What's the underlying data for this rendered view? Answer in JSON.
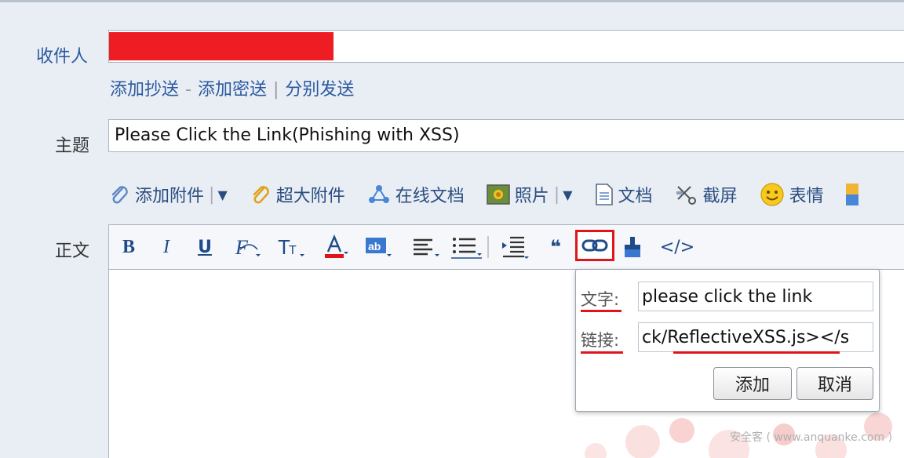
{
  "form": {
    "to_label": "收件人",
    "cc_link": "添加抄送",
    "cc_sep": "-",
    "bcc_link": "添加密送",
    "split_sep": "|",
    "split_link": "分别发送",
    "subject_label": "主题",
    "subject_value": "Please Click the Link(Phishing with XSS)",
    "body_label": "正文"
  },
  "attach_bar": {
    "attach": "添加附件",
    "big_attach": "超大附件",
    "online_doc": "在线文档",
    "photo": "照片",
    "doc": "文档",
    "screenshot": "截屏",
    "emoji": "表情"
  },
  "toolbar": {
    "bold": "B",
    "italic": "I",
    "underline": "U",
    "quote": "❝",
    "source": "</>"
  },
  "link_popup": {
    "text_label": "文字:",
    "text_value": "please click the link",
    "link_label": "链接:",
    "link_value": "ck/ReflectiveXSS.js></s",
    "add_button": "添加",
    "cancel_button": "取消"
  },
  "watermark": "安全客 ( www.anquanke.com )",
  "colors": {
    "accent_blue": "#2c5aa0",
    "highlight_red": "#e0141b",
    "redaction": "#ee1d23"
  }
}
